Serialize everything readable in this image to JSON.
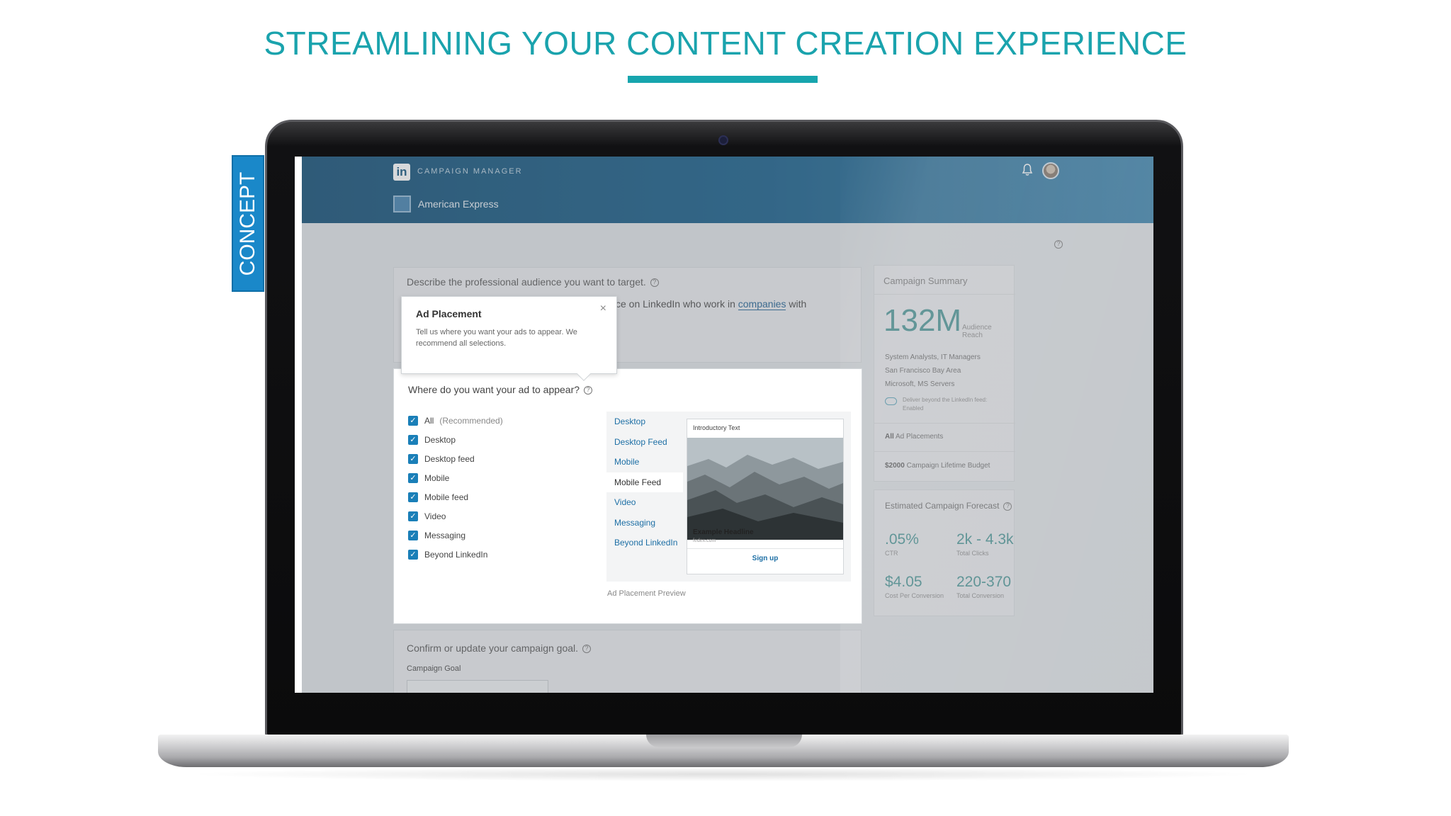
{
  "slide": {
    "title": "STREAMLINING YOUR CONTENT CREATION EXPERIENCE",
    "side_tab": "CONCEPT",
    "accent_color": "#1aa3ad",
    "tab_color": "#1a88c9"
  },
  "app": {
    "logo_text": "in",
    "app_name": "CAMPAIGN MANAGER",
    "account_name": "American Express",
    "header_color": "#0e5885"
  },
  "audience": {
    "question": "Describe the professional audience you want to target.",
    "sentence_visible": "ce on LinkedIn who work in",
    "link_text": "companies",
    "sentence_tail": "with"
  },
  "tooltip": {
    "title": "Ad Placement",
    "body": "Tell us where you want your ads to appear. We recommend all selections.",
    "close_glyph": "×"
  },
  "placement": {
    "question": "Where do you want your ad to appear?",
    "options": [
      {
        "label": "All",
        "note": "(Recommended)",
        "checked": true
      },
      {
        "label": "Desktop",
        "note": "",
        "checked": true
      },
      {
        "label": "Desktop feed",
        "note": "",
        "checked": true
      },
      {
        "label": "Mobile",
        "note": "",
        "checked": true
      },
      {
        "label": "Mobile feed",
        "note": "",
        "checked": true
      },
      {
        "label": "Video",
        "note": "",
        "checked": true
      },
      {
        "label": "Messaging",
        "note": "",
        "checked": true
      },
      {
        "label": "Beyond LinkedIn",
        "note": "",
        "checked": true
      }
    ],
    "preview_tabs": [
      "Desktop",
      "Desktop Feed",
      "Mobile",
      "Mobile Feed",
      "Video",
      "Messaging",
      "Beyond LinkedIn"
    ],
    "active_preview_tab": "Mobile Feed",
    "preview_caption": "Ad Placement Preview",
    "ad": {
      "intro": "Introductory Text",
      "headline": "Example Headline",
      "domain": "fedex.com",
      "cta": "Sign up"
    }
  },
  "goal": {
    "question": "Confirm or update your campaign goal.",
    "label": "Campaign Goal"
  },
  "summary": {
    "title": "Campaign Summary",
    "reach": "132M",
    "reach_label": "Audience Reach",
    "criteria": [
      "System Analysts, IT Managers",
      "San Francisco Bay Area",
      "Microsoft, MS Servers"
    ],
    "deliver_text": "Deliver beyond the LinkedIn feed: Enabled",
    "placements_bold": "All",
    "placements_rest": "Ad Placements",
    "budget_bold": "$2000",
    "budget_rest": "Campaign Lifetime Budget"
  },
  "forecast": {
    "title": "Estimated Campaign Forecast",
    "metrics": [
      {
        "value": ".05%",
        "label": "CTR"
      },
      {
        "value": "2k - 4.3k",
        "label": "Total Clicks"
      },
      {
        "value": "$4.05",
        "label": "Cost Per Conversion"
      },
      {
        "value": "220-370",
        "label": "Total Conversion"
      }
    ]
  }
}
